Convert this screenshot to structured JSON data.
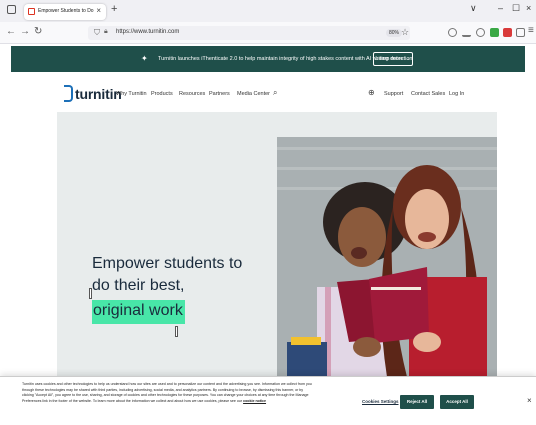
{
  "browser": {
    "tab_title": "Empower Students to Do Their",
    "tab_close": "×",
    "new_tab": "+",
    "url": "https://www.turnitin.com",
    "zoom": "80%",
    "window_minimize": "–",
    "window_maximize": "☐",
    "window_close": "×",
    "list_all_tabs": "∨"
  },
  "announcement": {
    "text": "Turnitin launches iThenticate 2.0 to help maintain integrity of high stakes content with AI writing detection",
    "button": "Learn more →"
  },
  "header": {
    "logo": "turnitin",
    "nav": [
      "Why Turnitin",
      "Products",
      "Resources",
      "Partners",
      "Media Center"
    ],
    "right_links": [
      "Support",
      "Contact Sales",
      "Log In"
    ]
  },
  "hero": {
    "line1": "Empower students to",
    "line2": "do their best,",
    "highlight": "original work"
  },
  "cookie": {
    "text": "Turnitin uses cookies and other technologies to help us understand how our sites are used and to personalize our content and the advertising you see. Information we collect from you through these technologies may be shared with third parties, including advertising, social media, and analytics partners. By continuing to browse, by dismissing this banner, or by clicking \"Accept All\", you agree to the use, sharing, and storage of cookies and other technologies for these purposes. You can change your choices at any time through the Manage Preferences link in the footer of the website. To learn more about the information we collect and about how we use cookies, please see our",
    "link": "cookie notice",
    "settings": "Cookies Settings",
    "reject": "Reject All",
    "accept": "Accept All",
    "close": "×"
  },
  "colors": {
    "brand_dark": "#1f4f4a",
    "highlight": "#48e6a8",
    "logo_blue": "#1d70b8"
  }
}
